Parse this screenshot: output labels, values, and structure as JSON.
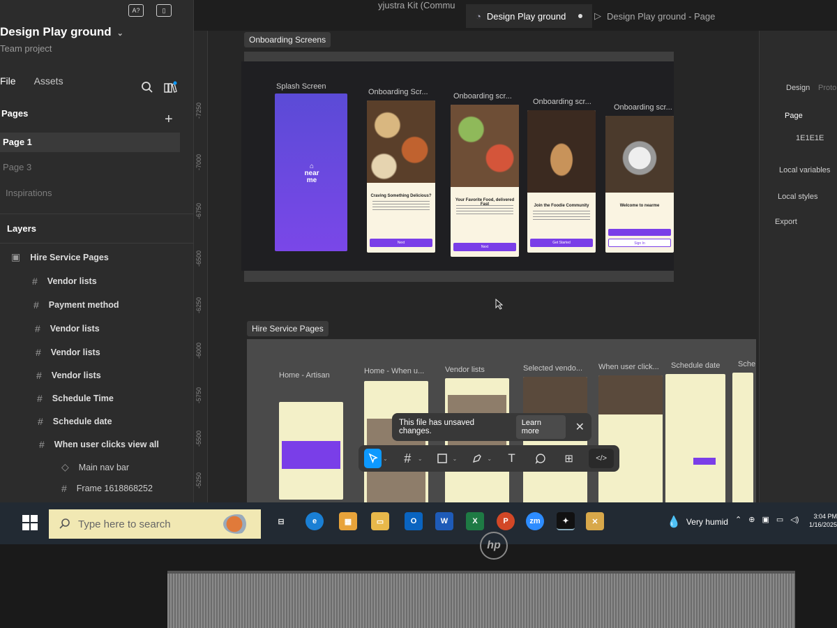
{
  "project": {
    "title": "Design Play ground",
    "subtitle": "Team project"
  },
  "left_tabs": {
    "file": "File",
    "assets": "Assets"
  },
  "pages": {
    "heading": "Pages",
    "items": [
      "Page 1",
      "Page 3",
      "Inspirations"
    ]
  },
  "layers": {
    "heading": "Layers",
    "root": "Hire Service Pages",
    "items": [
      "Vendor lists",
      "Payment method",
      "Vendor lists",
      "Vendor lists",
      "Vendor lists",
      "Schedule Time",
      "Schedule date",
      "When user clicks view all"
    ],
    "children": [
      "Main nav bar",
      "Frame 1618868252"
    ]
  },
  "file_tabs": {
    "partial": "yjustra Kit (Commu",
    "active": "Design Play ground",
    "next": "Design Play ground - Page"
  },
  "rulers": {
    "vertical": [
      "-7250",
      "-7000",
      "-6750",
      "-6500",
      "-6250",
      "-6000",
      "-5750",
      "-5500",
      "-5250"
    ]
  },
  "onboarding": {
    "label": "Onboarding Screens",
    "splash_label": "Splash Screen",
    "splash_logo": "near me",
    "screens": [
      {
        "label": "Onboarding Scr...",
        "title": "Craving Something Delicious?",
        "btn": "Next"
      },
      {
        "label": "Onboarding scr...",
        "title": "Your Favorite Food, delivered Fast",
        "btn": "Next"
      },
      {
        "label": "Onboarding scr...",
        "title": "Join the Foodie Community",
        "btn": "Get Started"
      },
      {
        "label": "Onboarding scr...",
        "title": "Welcome to nearme",
        "btn": "Sign In"
      }
    ]
  },
  "hire": {
    "label": "Hire Service Pages",
    "screens": [
      "Home - Artisan",
      "Home - When u...",
      "Vendor lists",
      "Selected vendo...",
      "When user click...",
      "Schedule date",
      "Sche"
    ]
  },
  "right_panel": {
    "design": "Design",
    "prototype": "Proto",
    "page": "Page",
    "page_color": "1E1E1E",
    "local_variables": "Local variables",
    "local_styles": "Local styles",
    "export": "Export"
  },
  "toast": {
    "message": "This file has unsaved changes.",
    "action": "Learn more"
  },
  "taskbar": {
    "search_placeholder": "Type here to search",
    "weather": "Very humid",
    "time": "3:04 PM",
    "date": "1/16/2025"
  },
  "laptop": {
    "brand": "hp"
  }
}
